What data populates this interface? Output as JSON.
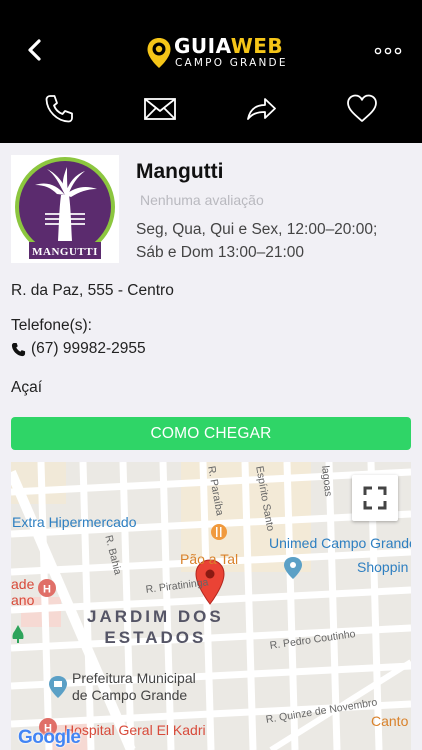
{
  "header": {
    "logo_brand_part1": "GUIA",
    "logo_brand_part2": "WEB",
    "logo_subtitle": "CAMPO GRANDE",
    "back_icon": "chevron-left-icon",
    "more_icon": "more-dots-icon",
    "actions": [
      {
        "id": "call",
        "icon": "phone-icon"
      },
      {
        "id": "email",
        "icon": "envelope-icon"
      },
      {
        "id": "share",
        "icon": "share-icon"
      },
      {
        "id": "favorite",
        "icon": "heart-icon"
      }
    ],
    "accent_color": "#f5c518"
  },
  "place": {
    "name": "Mangutti",
    "logo_text": "MANGUTTI",
    "rating": "Nenhuma avaliação",
    "hours_line1": "Seg, Qua, Qui e Sex, 12:00–20:00;",
    "hours_line2": "Sáb e Dom 13:00–21:00",
    "address": "R. da Paz, 555 - Centro",
    "phone_label": "Telefone(s):",
    "phone": "(67) 99982-2955",
    "category": "Açaí"
  },
  "route_button": {
    "label": "COMO CHEGAR",
    "color": "#2fd567"
  },
  "map": {
    "labels": {
      "extra": "Extra Hipermercado",
      "bahia": "R. Bahia",
      "paraiba": "R. Paraíba",
      "espirito_santo": "Espírito Santo",
      "lagoas": "lagoas",
      "pao_a_tal": "Pão a Tal",
      "unimed": "Unimed Campo Grande",
      "shopping": "Shoppin",
      "piratininga": "R. Piratininga",
      "district_line1": "JARDIM DOS",
      "district_line2": "ESTADOS",
      "pedro_coutinho": "R. Pedro Coutinho",
      "prefeitura_line1": "Prefeitura Municipal",
      "prefeitura_line2": "de Campo Grande",
      "quinze": "R. Quinze de Novembro",
      "canto": "Canto",
      "hospital": "Hospital Geral El Kadri",
      "left_partial_1": "ade",
      "left_partial_2": "ano"
    },
    "fullscreen_icon": "fullscreen-icon",
    "attribution": "Google",
    "marker_color": "#ea4335"
  }
}
